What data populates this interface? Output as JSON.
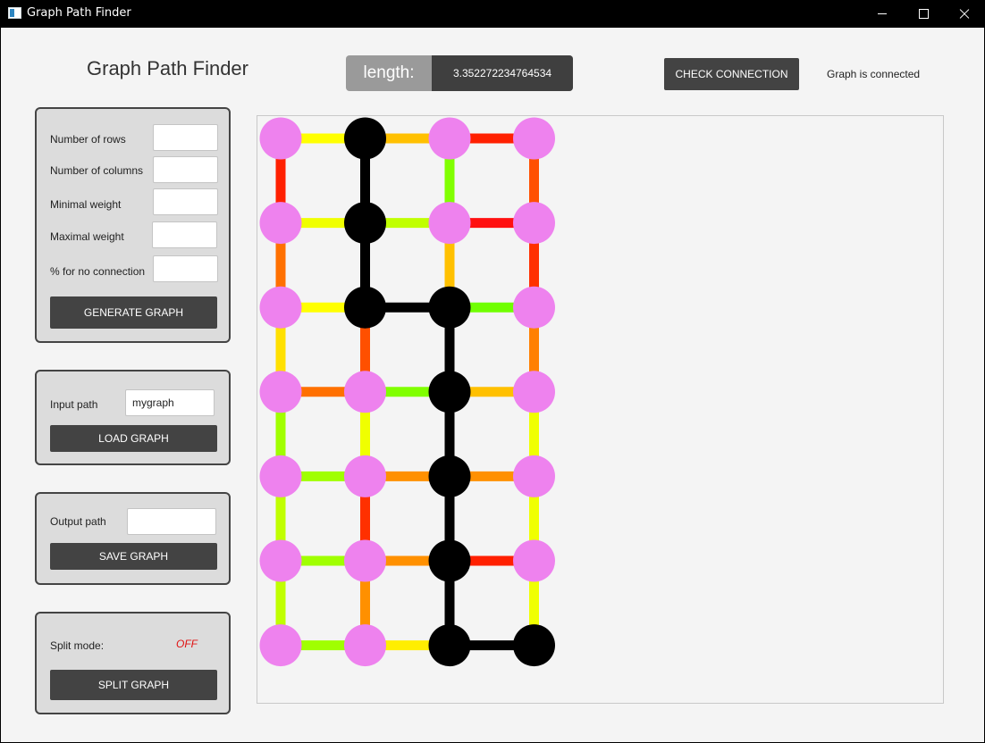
{
  "window": {
    "title": "Graph Path Finder"
  },
  "header": {
    "title": "Graph Path Finder",
    "length_label": "length:",
    "length_value": "3.352272234764534",
    "check_button": "CHECK CONNECTION",
    "connection_status": "Graph is connected"
  },
  "generate_panel": {
    "rows_label": "Number of rows",
    "rows_value": "",
    "columns_label": "Number of columns",
    "columns_value": "",
    "min_weight_label": "Minimal weight",
    "min_weight_value": "",
    "max_weight_label": "Maximal weight",
    "max_weight_value": "",
    "no_connection_label": "% for no connection",
    "no_connection_value": "",
    "button": "GENERATE GRAPH"
  },
  "load_panel": {
    "label": "Input path",
    "value": "mygraph",
    "button": "LOAD GRAPH"
  },
  "save_panel": {
    "label": "Output path",
    "value": "",
    "button": "SAVE GRAPH"
  },
  "split_panel": {
    "label": "Split mode:",
    "state": "OFF",
    "button": "SPLIT GRAPH"
  },
  "graph": {
    "rows": 7,
    "columns": 4,
    "node_color": "#ee82ee",
    "path_color": "#000000",
    "path_nodes": [
      [
        0,
        1
      ],
      [
        1,
        1
      ],
      [
        2,
        1
      ],
      [
        2,
        2
      ],
      [
        3,
        2
      ],
      [
        4,
        2
      ],
      [
        5,
        2
      ],
      [
        6,
        2
      ],
      [
        6,
        3
      ]
    ],
    "horizontal_edges": [
      [
        "#ffff00",
        "#ffc000",
        "#ff2000"
      ],
      [
        "#f0ff00",
        "#c0ff00",
        "#ff1010"
      ],
      [
        "#ffff00",
        "#000000",
        "#70ff00"
      ],
      [
        "#ff7000",
        "#80ff00",
        "#ffc000"
      ],
      [
        "#a0ff00",
        "#ff9000",
        "#ff9000"
      ],
      [
        "#a0ff00",
        "#ff9000",
        "#ff2000"
      ],
      [
        "#a0ff00",
        "#ffee00",
        "#000000"
      ]
    ],
    "vertical_edges": [
      [
        "#ff2000",
        "#000000",
        "#80ff00",
        "#ff5000"
      ],
      [
        "#ff7000",
        "#000000",
        "#ffc000",
        "#ff3000"
      ],
      [
        "#ffe000",
        "#ff5000",
        "#000000",
        "#ff8000"
      ],
      [
        "#a0ff00",
        "#f0ff00",
        "#000000",
        "#f0ff00"
      ],
      [
        "#c0ff00",
        "#ff3000",
        "#000000",
        "#f0ff00"
      ],
      [
        "#c0ff00",
        "#ff9000",
        "#000000",
        "#f0ff00"
      ]
    ]
  }
}
